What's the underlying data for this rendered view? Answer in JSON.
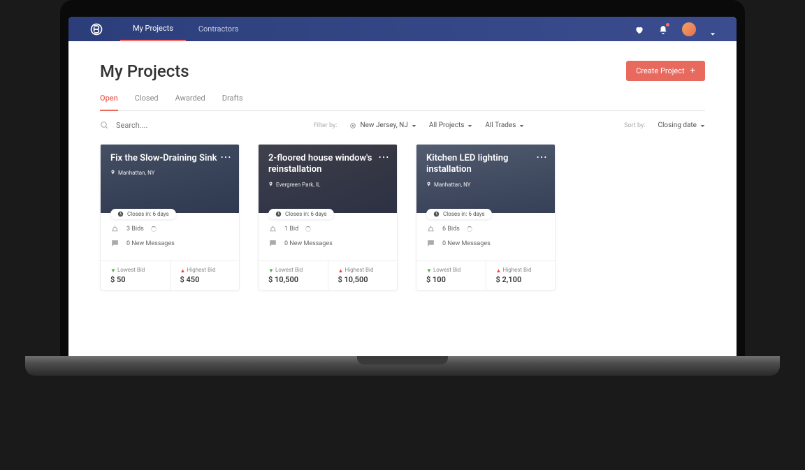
{
  "nav": {
    "items": [
      "My Projects",
      "Contractors"
    ],
    "activeIndex": 0
  },
  "page": {
    "title": "My Projects",
    "createButton": "Create Project"
  },
  "tabs": {
    "items": [
      "Open",
      "Closed",
      "Awarded",
      "Drafts"
    ],
    "activeIndex": 0
  },
  "search": {
    "placeholder": "Search...."
  },
  "filters": {
    "label": "Filter by:",
    "location": "New Jersey, NJ",
    "projects": "All Projects",
    "trades": "All Trades",
    "sortLabel": "Sort by:",
    "sort": "Closing date"
  },
  "cards": [
    {
      "title": "Fix the Slow-Draining Sink",
      "location": "Manhattan, NY",
      "closes": "Closes in: 6 days",
      "bids": "3 Bids",
      "messages": "0 New Messages",
      "lowestLabel": "Lowest Bid",
      "lowestValue": "$ 50",
      "highestLabel": "Highest Bid",
      "highestValue": "$ 450"
    },
    {
      "title": "2-floored house window's reinstallation",
      "location": "Evergreen Park, IL",
      "closes": "Closes in: 6 days",
      "bids": "1 Bid",
      "messages": "0 New Messages",
      "lowestLabel": "Lowest Bid",
      "lowestValue": "$ 10,500",
      "highestLabel": "Highest Bid",
      "highestValue": "$ 10,500"
    },
    {
      "title": "Kitchen LED lighting installation",
      "location": "Manhattan, NY",
      "closes": "Closes in: 6 days",
      "bids": "6 Bids",
      "messages": "0 New Messages",
      "lowestLabel": "Lowest Bid",
      "lowestValue": "$ 100",
      "highestLabel": "Highest Bid",
      "highestValue": "$ 2,100"
    }
  ]
}
